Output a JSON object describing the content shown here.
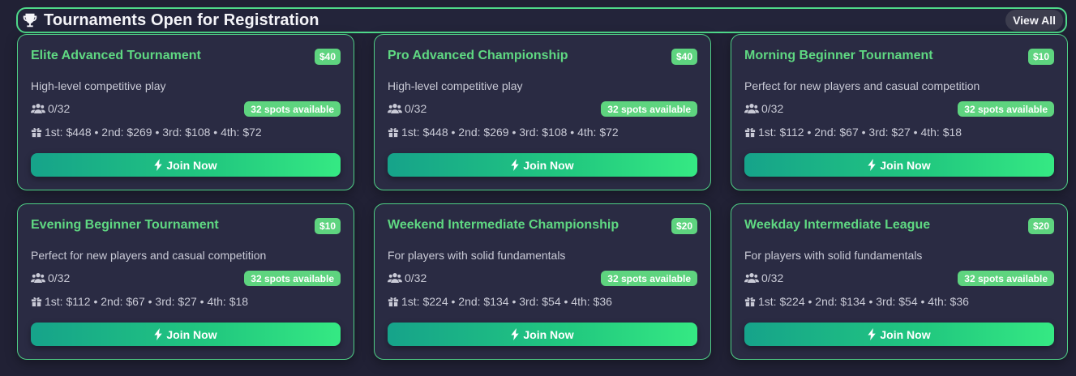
{
  "header": {
    "title": "Tournaments Open for Registration",
    "view_all_label": "View All",
    "icon": "trophy-icon"
  },
  "colors": {
    "accent": "#5ed47f",
    "background": "#212135",
    "card": "#2a2b43"
  },
  "tournaments": [
    {
      "name": "Elite Advanced Tournament",
      "fee": "$40",
      "description": "High-level competitive play",
      "players": "0/32",
      "spots": "32 spots available",
      "prizes": "1st: $448 • 2nd: $269 • 3rd: $108 • 4th: $72",
      "join_label": "Join Now"
    },
    {
      "name": "Pro Advanced Championship",
      "fee": "$40",
      "description": "High-level competitive play",
      "players": "0/32",
      "spots": "32 spots available",
      "prizes": "1st: $448 • 2nd: $269 • 3rd: $108 • 4th: $72",
      "join_label": "Join Now"
    },
    {
      "name": "Morning Beginner Tournament",
      "fee": "$10",
      "description": "Perfect for new players and casual competition",
      "players": "0/32",
      "spots": "32 spots available",
      "prizes": "1st: $112 • 2nd: $67 • 3rd: $27 • 4th: $18",
      "join_label": "Join Now"
    },
    {
      "name": "Evening Beginner Tournament",
      "fee": "$10",
      "description": "Perfect for new players and casual competition",
      "players": "0/32",
      "spots": "32 spots available",
      "prizes": "1st: $112 • 2nd: $67 • 3rd: $27 • 4th: $18",
      "join_label": "Join Now"
    },
    {
      "name": "Weekend Intermediate Championship",
      "fee": "$20",
      "description": "For players with solid fundamentals",
      "players": "0/32",
      "spots": "32 spots available",
      "prizes": "1st: $224 • 2nd: $134 • 3rd: $54 • 4th: $36",
      "join_label": "Join Now"
    },
    {
      "name": "Weekday Intermediate League",
      "fee": "$20",
      "description": "For players with solid fundamentals",
      "players": "0/32",
      "spots": "32 spots available",
      "prizes": "1st: $224 • 2nd: $134 • 3rd: $54 • 4th: $36",
      "join_label": "Join Now"
    }
  ]
}
